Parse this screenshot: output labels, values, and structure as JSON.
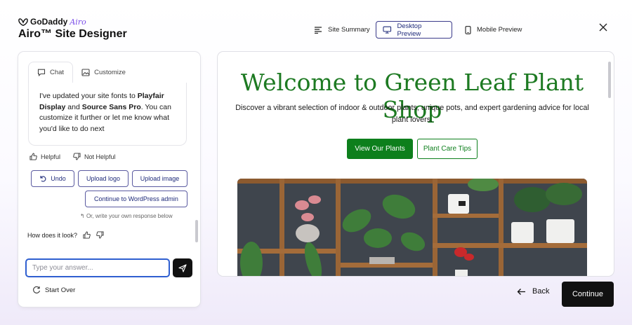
{
  "brand": {
    "name": "GoDaddy",
    "product": "Airo"
  },
  "app_title": "Airo™ Site Designer",
  "nav": {
    "summary": "Site Summary",
    "desktop": "Desktop Preview",
    "mobile": "Mobile Preview",
    "active": "desktop"
  },
  "chat": {
    "tabs": [
      "Chat",
      "Customize"
    ],
    "message": {
      "part1": "I've updated your site fonts to ",
      "font1": "Playfair Display",
      "part2": " and ",
      "font2": "Source Sans Pro",
      "part3": ". You can customize it further or let me know what you'd like to do next"
    },
    "helpful": "Helpful",
    "not_helpful": "Not Helpful",
    "actions": {
      "undo": "Undo",
      "upload_logo": "Upload logo",
      "upload_image": "Upload image",
      "continue_wp": "Continue to WordPress admin"
    },
    "hint": "Or, write your own response below",
    "look_question": "How does it look?",
    "input_placeholder": "Type your answer...",
    "start_over": "Start Over"
  },
  "preview": {
    "title": "Welcome to Green Leaf Plant Shop",
    "subtitle": "Discover a vibrant selection of indoor & outdoor plants, unique pots, and expert gardening advice for local plant lovers.",
    "primary_button": "View Our Plants",
    "secondary_button": "Plant Care Tips"
  },
  "footer": {
    "back": "Back",
    "continue": "Continue"
  },
  "colors": {
    "accent": "#1f2b7a",
    "brand_purple": "#7a4de8",
    "site_green": "#1d7a22",
    "button_green": "#0d7f1c"
  }
}
